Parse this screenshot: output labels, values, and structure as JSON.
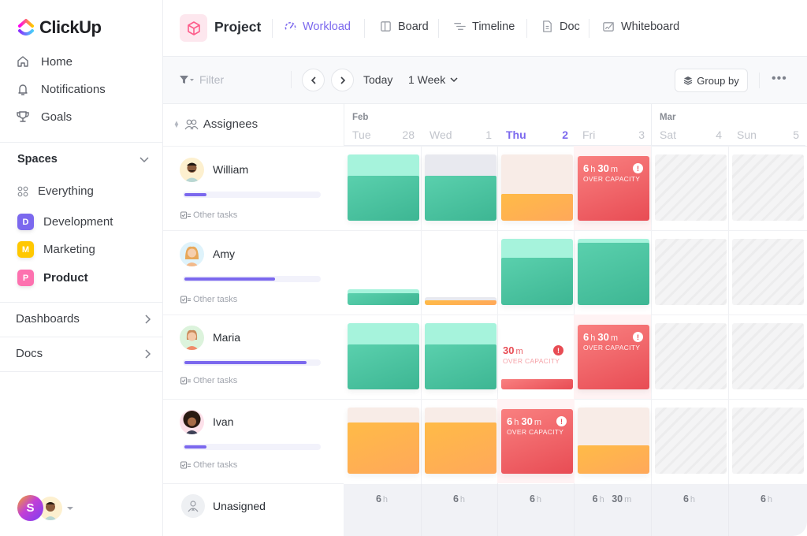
{
  "app": {
    "brand": "ClickUp"
  },
  "sidebar": {
    "nav": [
      {
        "label": "Home",
        "icon": "home-icon"
      },
      {
        "label": "Notifications",
        "icon": "bell-icon"
      },
      {
        "label": "Goals",
        "icon": "trophy-icon"
      }
    ],
    "spaces_title": "Spaces",
    "everything_label": "Everything",
    "spaces": [
      {
        "letter": "D",
        "label": "Development",
        "color": "#7b68ee"
      },
      {
        "letter": "M",
        "label": "Marketing",
        "color": "#ffc800"
      },
      {
        "letter": "P",
        "label": "Product",
        "color": "#fd71af",
        "active": true
      }
    ],
    "links": [
      {
        "label": "Dashboards"
      },
      {
        "label": "Docs"
      }
    ],
    "user_initial": "S"
  },
  "header": {
    "project_title": "Project",
    "tabs": [
      {
        "label": "Workload",
        "icon": "workload-gauge-icon",
        "active": true
      },
      {
        "label": "Board",
        "icon": "board-icon"
      },
      {
        "label": "Timeline",
        "icon": "timeline-icon"
      },
      {
        "label": "Doc",
        "icon": "doc-icon"
      },
      {
        "label": "Whiteboard",
        "icon": "whiteboard-icon"
      }
    ]
  },
  "toolbar": {
    "filter_placeholder": "Filter",
    "today_label": "Today",
    "range_label": "1 Week",
    "group_by_label": "Group by"
  },
  "workload": {
    "assignees_header": "Assignees",
    "other_tasks_label": "Other tasks",
    "unassigned_label": "Unasigned",
    "over_capacity_label": "OVER CAPACITY",
    "days": [
      {
        "month": "Feb",
        "name": "Tue",
        "num": "28"
      },
      {
        "month": "",
        "name": "Wed",
        "num": "1"
      },
      {
        "month": "",
        "name": "Thu",
        "num": "2",
        "today": true
      },
      {
        "month": "",
        "name": "Fri",
        "num": "3"
      },
      {
        "month": "Mar",
        "name": "Sat",
        "num": "4"
      },
      {
        "month": "",
        "name": "Sun",
        "num": "5"
      }
    ],
    "people": [
      {
        "name": "William",
        "capacity_used_pct": 18,
        "cells": [
          {
            "kind": "green",
            "bg": "green",
            "fill_pct": 68
          },
          {
            "kind": "green",
            "bg": "grey",
            "fill_pct": 68
          },
          {
            "kind": "orange",
            "bg": "peach",
            "fill_pct": 40
          },
          {
            "kind": "over",
            "hours": "6",
            "minutes": "30"
          },
          {
            "kind": "weekend"
          },
          {
            "kind": "weekend"
          }
        ]
      },
      {
        "name": "Amy",
        "capacity_used_pct": 68,
        "cells": [
          {
            "kind": "green",
            "bg": "green",
            "fill_pct": 18,
            "bg_pct": 24
          },
          {
            "kind": "orange",
            "bg": "grey",
            "fill_pct": 7,
            "bg_pct": 12
          },
          {
            "kind": "green",
            "bg": "green",
            "fill_pct": 72
          },
          {
            "kind": "green",
            "bg": "green",
            "fill_pct": 94
          },
          {
            "kind": "weekend"
          },
          {
            "kind": "weekend"
          }
        ]
      },
      {
        "name": "Maria",
        "capacity_used_pct": 91,
        "cells": [
          {
            "kind": "green",
            "bg": "green",
            "fill_pct": 68
          },
          {
            "kind": "green",
            "bg": "green",
            "fill_pct": 68
          },
          {
            "kind": "over-small",
            "minutes": "30",
            "fill_pct": 15
          },
          {
            "kind": "over",
            "hours": "6",
            "minutes": "30"
          },
          {
            "kind": "weekend"
          },
          {
            "kind": "weekend"
          }
        ]
      },
      {
        "name": "Ivan",
        "capacity_used_pct": 18,
        "cells": [
          {
            "kind": "orange",
            "bg": "peach",
            "fill_pct": 77
          },
          {
            "kind": "orange",
            "bg": "peach",
            "fill_pct": 77
          },
          {
            "kind": "over",
            "hours": "6",
            "minutes": "30"
          },
          {
            "kind": "orange",
            "bg": "peach",
            "fill_pct": 43
          },
          {
            "kind": "weekend"
          },
          {
            "kind": "weekend"
          }
        ]
      }
    ],
    "totals": [
      {
        "hours": "6",
        "minutes": ""
      },
      {
        "hours": "6",
        "minutes": ""
      },
      {
        "hours": "6",
        "minutes": ""
      },
      {
        "hours": "6",
        "minutes": "30"
      },
      {
        "hours": "6",
        "minutes": ""
      },
      {
        "hours": "6",
        "minutes": ""
      }
    ],
    "units": {
      "h": "h",
      "m": "m"
    }
  }
}
